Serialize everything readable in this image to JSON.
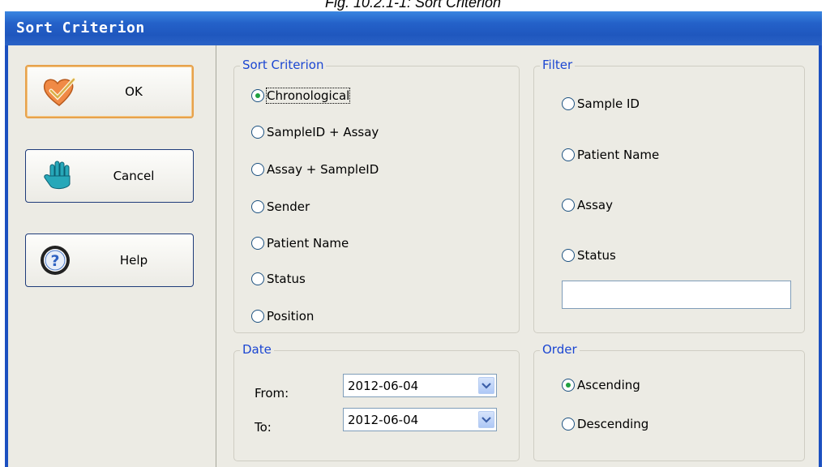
{
  "caption": "Fig. 10.2.1-1: Sort Criterion",
  "window": {
    "title": "Sort Criterion"
  },
  "buttons": {
    "ok": {
      "label": "OK",
      "icon": "check-heart-icon"
    },
    "cancel": {
      "label": "Cancel",
      "icon": "hand-stop-icon"
    },
    "help": {
      "label": "Help",
      "icon": "question-icon"
    }
  },
  "sort_criterion": {
    "legend": "Sort Criterion",
    "options": [
      "Chronological",
      "SampleID + Assay",
      "Assay + SampleID",
      "Sender",
      "Patient Name",
      "Status",
      "Position"
    ],
    "selected": "Chronological"
  },
  "filter": {
    "legend": "Filter",
    "options": [
      "Sample ID",
      "Patient Name",
      "Assay",
      "Status"
    ],
    "text_value": ""
  },
  "date": {
    "legend": "Date",
    "from_label": "From:",
    "from_value": "2012-06-04",
    "to_label": "To:",
    "to_value": "2012-06-04"
  },
  "order": {
    "legend": "Order",
    "options": [
      "Ascending",
      "Descending"
    ],
    "selected": "Ascending"
  },
  "colors": {
    "titlebar": "#2461c9",
    "legend_text": "#1b46d2",
    "radio_dot": "#20a040",
    "default_button_border": "#e7a24c"
  }
}
